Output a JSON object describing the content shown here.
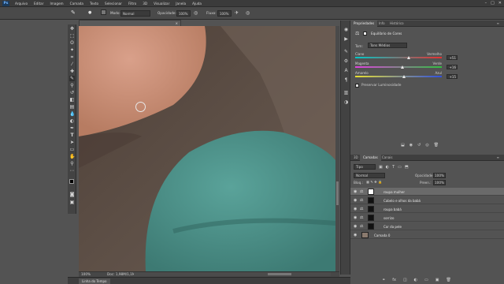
{
  "app": {
    "logo": "Ps",
    "menu": [
      "Arquivo",
      "Editar",
      "Imagem",
      "Camada",
      "Texto",
      "Selecionar",
      "Filtro",
      "3D",
      "Visualizar",
      "Janela",
      "Ajuda"
    ]
  },
  "window_controls": [
    "–",
    "□",
    "✕"
  ],
  "options_bar": {
    "mode_label": "Modo:",
    "mode_value": "Normal",
    "opacity_label": "Opacidade:",
    "opacity_value": "100%",
    "flow_label": "Fluxo:",
    "flow_value": "100%"
  },
  "document": {
    "tab_title": "cerveza.psd @ 100% (roupa mulher, Máscara de camada/8) *",
    "zoom": "100%",
    "doc_info": "Doc: 1,98M/1,1M"
  },
  "timeline": {
    "tab_label": "Linha do Tempo"
  },
  "properties_panel": {
    "tabs": [
      "Propriedades",
      "Info",
      "Histórico"
    ],
    "adjustment_title": "Equilíbrio de Cores",
    "tone_label": "Tom:",
    "tone_value": "Tons Médios",
    "sliders": [
      {
        "left": "Ciano",
        "right": "Vermelho",
        "value": "+51",
        "fraction": 0.62
      },
      {
        "left": "Magenta",
        "right": "Verde",
        "value": "+16",
        "fraction": 0.55
      },
      {
        "left": "Amarelo",
        "right": "Azul",
        "value": "+15",
        "fraction": 0.56
      }
    ],
    "preserve_luminosity": "Preservar Luminosidade",
    "colors": {
      "cyan_red_start": "#00c8c8",
      "cyan_red_end": "#e83030",
      "mag_green_start": "#e040e0",
      "mag_green_end": "#30c040",
      "yel_blue_start": "#e8e030",
      "yel_blue_end": "#3050e0"
    }
  },
  "layers_panel": {
    "tabs": [
      "3D",
      "Camadas",
      "Canais"
    ],
    "kind_label": "Tipo",
    "blend_mode": "Normal",
    "opacity_label": "Opacidade:",
    "opacity_value": "100%",
    "lock_label": "Bloq.:",
    "fill_label": "Preen.:",
    "fill_value": "100%",
    "layers": [
      {
        "name": "roupa mulher",
        "selected": true
      },
      {
        "name": "Cabelo e olhos da babá",
        "selected": false
      },
      {
        "name": "roupa babá",
        "selected": false
      },
      {
        "name": "sorrizo",
        "selected": false
      },
      {
        "name": "Cor da pele",
        "selected": false
      },
      {
        "name": "Camada 0",
        "selected": false
      }
    ]
  },
  "canvas_colors": {
    "skin": "#c98e74",
    "shirt": "#4c8c84",
    "background": "#5a4c43"
  }
}
